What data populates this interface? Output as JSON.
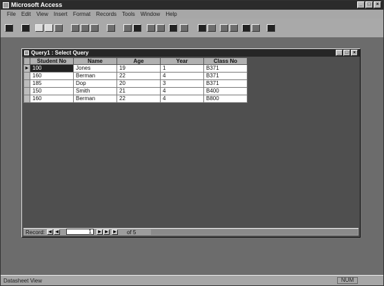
{
  "app": {
    "title": "Microsoft Access"
  },
  "menu": [
    "File",
    "Edit",
    "View",
    "Insert",
    "Format",
    "Records",
    "Tools",
    "Window",
    "Help"
  ],
  "query_window": {
    "title": "Query1 : Select Query",
    "columns": [
      "Student No",
      "Name",
      "Age",
      "Year",
      "Class No"
    ],
    "rows": [
      [
        "100",
        "Jones",
        "19",
        "1",
        "B371"
      ],
      [
        "160",
        "Berman",
        "22",
        "4",
        "B371"
      ],
      [
        "185",
        "Dop",
        "20",
        "3",
        "B371"
      ],
      [
        "150",
        "Smith",
        "21",
        "4",
        "B400"
      ],
      [
        "160",
        "Berman",
        "22",
        "4",
        "B800"
      ]
    ],
    "record_nav": {
      "label": "Record:",
      "current": "1",
      "of_label": "of 5"
    }
  },
  "status": {
    "text": "Datasheet View",
    "num": "NUM"
  }
}
